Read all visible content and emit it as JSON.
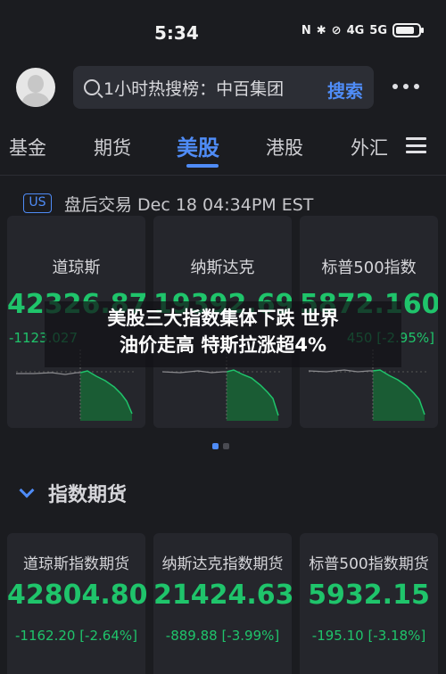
{
  "status_bar": {
    "time": "5:34",
    "network": "4G",
    "network2": "5G"
  },
  "search": {
    "text": "1小时热搜榜：中百集团",
    "button": "搜索"
  },
  "tabs": [
    {
      "label": "基金"
    },
    {
      "label": "期货"
    },
    {
      "label": "美股"
    },
    {
      "label": "港股"
    },
    {
      "label": "外汇"
    }
  ],
  "market": {
    "badge": "US",
    "status": "盘后交易  Dec 18 04:34PM EST"
  },
  "indices": [
    {
      "name": "道琼斯",
      "value": "42326.87",
      "change": "-1123.027"
    },
    {
      "name": "纳斯达克",
      "value": "19392.69",
      "change": ""
    },
    {
      "name": "标普500指数",
      "value": "5872.160",
      "change": "450 [-2.95%]"
    }
  ],
  "headline": {
    "line1": "美股三大指数集体下跌 世界",
    "line2": "油价走高 特斯拉涨超4%"
  },
  "futures": {
    "title": "指数期货",
    "items": [
      {
        "name": "道琼斯指数期货",
        "value": "42804.80",
        "change": "-1162.20 [-2.64%]"
      },
      {
        "name": "纳斯达克指数期货",
        "value": "21424.63",
        "change": "-889.88 [-3.99%]"
      },
      {
        "name": "标普500指数期货",
        "value": "5932.15",
        "change": "-195.10 [-3.18%]"
      }
    ]
  },
  "colors": {
    "accent": "#4f8cf7",
    "down": "#1fc46b",
    "background": "#1b1c20"
  }
}
